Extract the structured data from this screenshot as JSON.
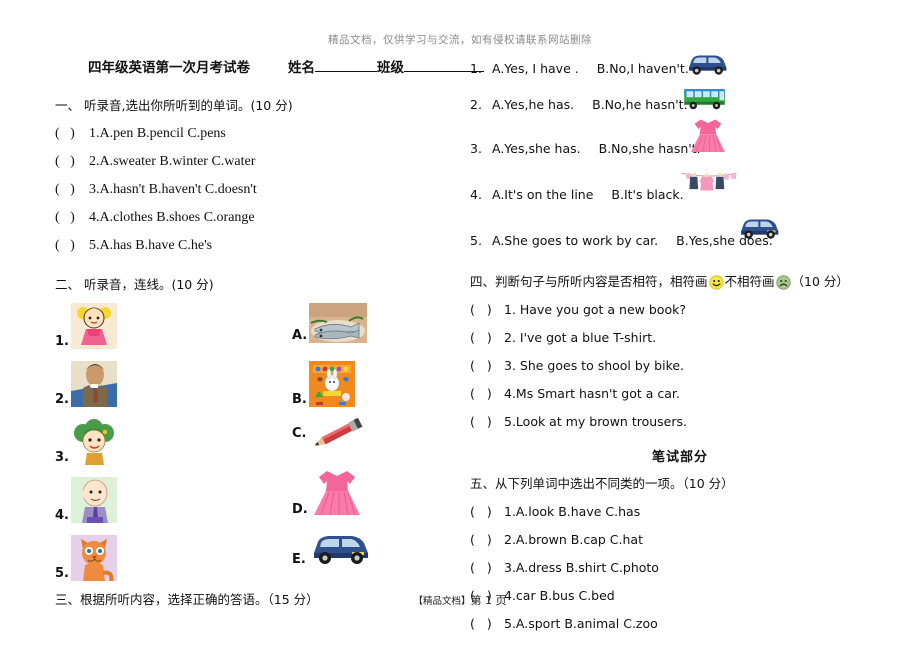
{
  "watermark": "精品文档，仅供学习与交流，如有侵权请联系网站删除",
  "header": {
    "exam_title": "四年级英语第一次月考试卷",
    "name_label": "姓名",
    "class_label": "班级"
  },
  "section1": {
    "heading": "一、  听录音,选出你所听到的单词。(10 分)",
    "items": [
      "1.A.pen      B.pencil   C.pens",
      "2.A.sweater   B.winter   C.water",
      "3.A.hasn't       B.haven't     C.doesn't",
      "4.A.clothes       B.shoes     C.orange",
      "5.A.has    B.have     C.he's"
    ]
  },
  "section2": {
    "heading": "二、  听录音，连线。(10 分)",
    "left_items": [
      {
        "label": "1.",
        "icon": "girl-pink-dress-image"
      },
      {
        "label": "2.",
        "icon": "man-in-suit-image"
      },
      {
        "label": "3.",
        "icon": "green-hair-girl-image"
      },
      {
        "label": "4.",
        "icon": "bald-old-man-image"
      },
      {
        "label": "5.",
        "icon": "orange-cat-image"
      }
    ],
    "right_items": [
      {
        "label": "A.",
        "icon": "fish-plate-image"
      },
      {
        "label": "B.",
        "icon": "orange-book-rabbit-image"
      },
      {
        "label": "C.",
        "icon": "red-pencil-image"
      },
      {
        "label": "D.",
        "icon": "pink-dress-image"
      },
      {
        "label": "E.",
        "icon": "blue-car-image"
      }
    ]
  },
  "section3": {
    "heading": "三、根据所听内容，选择正确的答语。（15 分）",
    "items": [
      {
        "num": "1.",
        "a": "A.Yes, I have .",
        "b": "B.No,I haven't.",
        "art": "blue-car-image"
      },
      {
        "num": "2.",
        "a": "A.Yes,he has.",
        "b": "B.No,he hasn't.",
        "art": "green-bus-image"
      },
      {
        "num": "3.",
        "a": "A.Yes,she has.",
        "b": "B.No,she hasn't.",
        "art": "pink-dress-image"
      },
      {
        "num": "4.",
        "a": "A.It's on the line",
        "b": "B.It's black.",
        "art": "clothesline-image"
      },
      {
        "num": "5.",
        "a": "A.She goes to work by car.",
        "b": "B.Yes,she does.",
        "art": "blue-car-image"
      }
    ]
  },
  "section4": {
    "heading_part1": "四、判断句子与所听内容是否相符，相符画",
    "heading_part2": "不相符画",
    "heading_part3": "（10 分）",
    "happy_icon": "smiley-happy-icon",
    "sad_icon": "smiley-sad-icon",
    "items": [
      "1.  Have you got a new book?",
      "2.   I've got a blue T-shirt.",
      "3.  She goes to shool by bike.",
      "4.Ms Smart hasn't got a car.",
      "5.Look at my brown trousers."
    ]
  },
  "written_part_title": "笔试部分",
  "section5": {
    "heading": "五、从下列单词中选出不同类的一项。（10 分）",
    "items": [
      "1.A.look   B.have     C.has",
      "2.A.brown   B.cap    C.hat",
      "3.A.dress    B.shirt   C.photo",
      "4.car     B.bus      C.bed",
      "5.A.sport   B.animal   C.zoo"
    ]
  },
  "footer": {
    "brand": "【精品文档】",
    "page": "第 1 页"
  },
  "colors": {
    "text": "#111111",
    "watermark": "#8a8a8a",
    "happy": "#f5e63a",
    "sad": "#8fba6f",
    "pink": "#f2629a",
    "car_blue": "#2f4f8f",
    "bus_green": "#2fa83f"
  }
}
